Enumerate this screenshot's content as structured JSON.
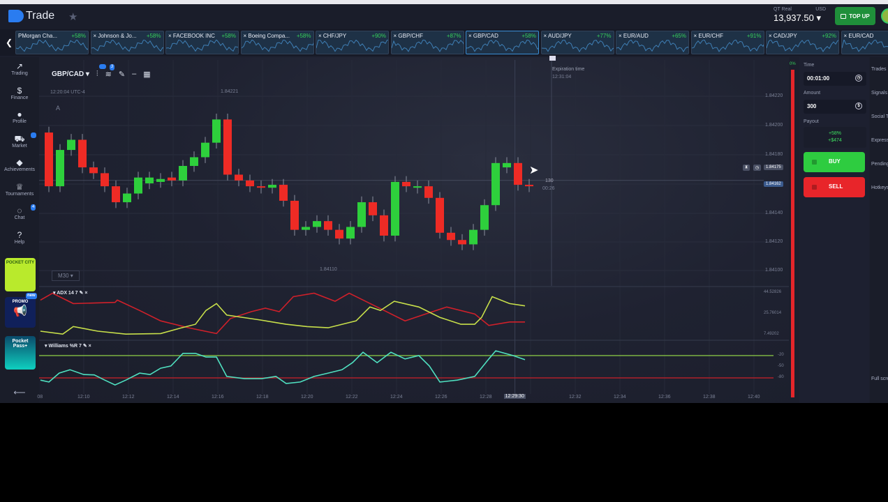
{
  "header": {
    "brand": "Trade",
    "balance_label": "QT Real",
    "currency": "USD",
    "balance": "13,937.50 ▾",
    "top_up": "TOP UP"
  },
  "tickers": [
    {
      "name": "PMorgan Cha...",
      "payout": "+58%"
    },
    {
      "name": "× Johnson & Jo...",
      "payout": "+58%"
    },
    {
      "name": "× FACEBOOK INC",
      "payout": "+58%"
    },
    {
      "name": "× Boeing Compa...",
      "payout": "+58%"
    },
    {
      "name": "× CHF/JPY",
      "payout": "+90%"
    },
    {
      "name": "× GBP/CHF",
      "payout": "+87%"
    },
    {
      "name": "× GBP/CAD",
      "payout": "+58%",
      "active": true
    },
    {
      "name": "× AUD/JPY",
      "payout": "+77%"
    },
    {
      "name": "× EUR/AUD",
      "payout": "+65%"
    },
    {
      "name": "× EUR/CHF",
      "payout": "+91%"
    },
    {
      "name": "× CAD/JPY",
      "payout": "+92%"
    },
    {
      "name": "× EUR/CAD",
      "payout": ""
    }
  ],
  "sidebar": {
    "items": [
      {
        "label": "Trading",
        "icon": "chart-icon"
      },
      {
        "label": "Finance",
        "icon": "dollar-icon"
      },
      {
        "label": "Profile",
        "icon": "user-icon"
      },
      {
        "label": "Market",
        "icon": "cart-icon"
      },
      {
        "label": "Achievements",
        "icon": "diamond-icon"
      },
      {
        "label": "Tournaments",
        "icon": "trophy-icon"
      },
      {
        "label": "Chat",
        "icon": "chat-icon",
        "badge": "4"
      },
      {
        "label": "Help",
        "icon": "help-icon"
      }
    ],
    "promos": {
      "city": "POCKET CITY",
      "promo": "PROMO",
      "pass": "Pocket Pass+",
      "new_badge": "new"
    }
  },
  "toolbar": {
    "pair": "GBP/CAD ▾",
    "badge2": "3"
  },
  "chart": {
    "clock": "12:20:04 UTC-4",
    "marker_a": "A",
    "timeframe": "M30 ▾",
    "high_label": "1.84221",
    "low_label": "1.84110",
    "expiration_label": "Expiration time",
    "expiration_time": "12:31:04",
    "timer_top": "130",
    "timer_bottom": "00:26",
    "price_tag_gray": "1.84175",
    "price_tag_current": "1.84162",
    "price_axis": [
      "1.84220",
      "1.84200",
      "1.84180",
      "1.84140",
      "1.84120",
      "1.84100"
    ],
    "time_axis": [
      "08",
      "12:10",
      "12:12",
      "12:14",
      "12:16",
      "12:18",
      "12:20",
      "12:22",
      "12:24",
      "12:26",
      "12:28",
      "12:32",
      "12:34",
      "12:36",
      "12:38",
      "12:40"
    ],
    "time_cursor": "12:29:30",
    "adx_label": "ADX 14 7",
    "adx_axis": [
      "44.52826",
      "25.76014",
      "7.49202"
    ],
    "wr_label": "Williams %R 7",
    "wr_axis": [
      "-20",
      "-50",
      "-80"
    ],
    "colors": {
      "up": "#2ed03c",
      "down": "#ee2b25",
      "adx_pos": "#c8e04a",
      "adx_neg": "#d0202a",
      "wr": "#4fe0c0",
      "wr_upper": "#7cb342",
      "wr_lower": "#b0202a"
    }
  },
  "trade_panel": {
    "time_label": "Time",
    "time_value": "00:01:00",
    "amount_label": "Amount",
    "amount_value": "300",
    "payout_label": "Payout",
    "payout_pct": "+58%",
    "payout_amount": "+$474",
    "buy": "BUY",
    "sell": "SELL",
    "meter_top": "0%"
  },
  "right_sidebar": [
    "Trades",
    "Signals",
    "Social Trading",
    "Express Trades",
    "Pending Trades",
    "Hotkeys",
    "Full screen"
  ],
  "chart_data": {
    "type": "candlestick",
    "symbol": "GBP/CAD",
    "candle_interval_min": 0.5,
    "first_candle_minute": 8.5,
    "price_range": [
      1.841,
      1.8422
    ],
    "time_range_minutes_after_12": [
      8,
      41
    ],
    "candles_open_close": [
      [
        1.84195,
        1.84158
      ],
      [
        1.84158,
        1.84183
      ],
      [
        1.84183,
        1.8419
      ],
      [
        1.8419,
        1.84171
      ],
      [
        1.84171,
        1.84167
      ],
      [
        1.84167,
        1.84158
      ],
      [
        1.84158,
        1.84147
      ],
      [
        1.84147,
        1.84153
      ],
      [
        1.84153,
        1.84164
      ],
      [
        1.8416,
        1.84164
      ],
      [
        1.84161,
        1.84163
      ],
      [
        1.84164,
        1.84162
      ],
      [
        1.84162,
        1.84172
      ],
      [
        1.84172,
        1.84178
      ],
      [
        1.84178,
        1.84188
      ],
      [
        1.84188,
        1.84204
      ],
      [
        1.84204,
        1.84166
      ],
      [
        1.84166,
        1.84162
      ],
      [
        1.84162,
        1.84158
      ],
      [
        1.84158,
        1.84157
      ],
      [
        1.84157,
        1.84159
      ],
      [
        1.84159,
        1.84148
      ],
      [
        1.84148,
        1.84128
      ],
      [
        1.84128,
        1.8413
      ],
      [
        1.8413,
        1.84134
      ],
      [
        1.84134,
        1.84128
      ],
      [
        1.84128,
        1.84122
      ],
      [
        1.84122,
        1.8413
      ],
      [
        1.8413,
        1.84147
      ],
      [
        1.84147,
        1.84138
      ],
      [
        1.84138,
        1.84124
      ],
      [
        1.84124,
        1.84161
      ],
      [
        1.84161,
        1.84158
      ],
      [
        1.84157,
        1.84158
      ],
      [
        1.84158,
        1.8415
      ],
      [
        1.8415,
        1.84126
      ],
      [
        1.84126,
        1.84121
      ],
      [
        1.84121,
        1.84118
      ],
      [
        1.84118,
        1.84128
      ],
      [
        1.84128,
        1.84145
      ],
      [
        1.84145,
        1.84174
      ],
      [
        1.84171,
        1.84174
      ],
      [
        1.84174,
        1.84159
      ],
      [
        1.84159,
        1.84158
      ]
    ],
    "adx_range": [
      7.49,
      44.53
    ],
    "adx_neg": [
      [
        8.06,
        37
      ],
      [
        8.6,
        43
      ],
      [
        9.53,
        34
      ],
      [
        11.4,
        35
      ],
      [
        11.5,
        37
      ],
      [
        12.5,
        28
      ],
      [
        13.44,
        19
      ],
      [
        14.69,
        13
      ],
      [
        15.94,
        8
      ],
      [
        16.56,
        21
      ],
      [
        17.5,
        27
      ],
      [
        18.13,
        30
      ],
      [
        18.75,
        27
      ],
      [
        19.38,
        40
      ],
      [
        20.31,
        43
      ],
      [
        21.25,
        36
      ],
      [
        21.88,
        43
      ],
      [
        23.13,
        31
      ],
      [
        24.38,
        19
      ],
      [
        25.31,
        25
      ],
      [
        26.25,
        31
      ],
      [
        27.5,
        25
      ],
      [
        28.13,
        15
      ],
      [
        29.06,
        18
      ],
      [
        29.75,
        18
      ]
    ],
    "adx_pos": [
      [
        8.06,
        10
      ],
      [
        9.06,
        7.5
      ],
      [
        9.53,
        14
      ],
      [
        10.63,
        10
      ],
      [
        11.88,
        7.5
      ],
      [
        13.44,
        8
      ],
      [
        14.38,
        13
      ],
      [
        15,
        16
      ],
      [
        15.47,
        28
      ],
      [
        15.94,
        34
      ],
      [
        16.4,
        24
      ],
      [
        17.81,
        20
      ],
      [
        19.06,
        16
      ],
      [
        20,
        14
      ],
      [
        20.94,
        13
      ],
      [
        22.19,
        19
      ],
      [
        22.81,
        31
      ],
      [
        23.28,
        28
      ],
      [
        23.9,
        36
      ],
      [
        25,
        31
      ],
      [
        25.94,
        22
      ],
      [
        26.88,
        16
      ],
      [
        27.5,
        16
      ],
      [
        27.81,
        22
      ],
      [
        28.28,
        40
      ],
      [
        29.06,
        34
      ],
      [
        29.75,
        32
      ]
    ],
    "wr_range": [
      -100,
      0
    ],
    "wr_levels": [
      -20,
      -80
    ],
    "williams_r": [
      [
        8.06,
        -86
      ],
      [
        8.44,
        -91
      ],
      [
        8.9,
        -67
      ],
      [
        9.38,
        -58
      ],
      [
        10,
        -71
      ],
      [
        10.47,
        -72
      ],
      [
        10.94,
        -86
      ],
      [
        11.4,
        -99
      ],
      [
        11.88,
        -86
      ],
      [
        12.5,
        -67
      ],
      [
        12.97,
        -71
      ],
      [
        13.44,
        -54
      ],
      [
        13.9,
        -48
      ],
      [
        14.44,
        -14
      ],
      [
        15,
        -14
      ],
      [
        15.47,
        -24
      ],
      [
        15.94,
        -24
      ],
      [
        16.4,
        -76
      ],
      [
        17.19,
        -82
      ],
      [
        17.97,
        -82
      ],
      [
        18.6,
        -76
      ],
      [
        19.06,
        -95
      ],
      [
        19.69,
        -91
      ],
      [
        20.31,
        -76
      ],
      [
        20.94,
        -67
      ],
      [
        21.56,
        -58
      ],
      [
        22.03,
        -39
      ],
      [
        22.5,
        -11
      ],
      [
        23.13,
        -39
      ],
      [
        23.75,
        -11
      ],
      [
        24.38,
        -29
      ],
      [
        25,
        -20
      ],
      [
        25.47,
        -48
      ],
      [
        25.94,
        -91
      ],
      [
        26.72,
        -86
      ],
      [
        27.5,
        -76
      ],
      [
        28.13,
        -29
      ],
      [
        28.44,
        -7
      ],
      [
        29.22,
        -20
      ],
      [
        29.75,
        -31
      ]
    ]
  }
}
